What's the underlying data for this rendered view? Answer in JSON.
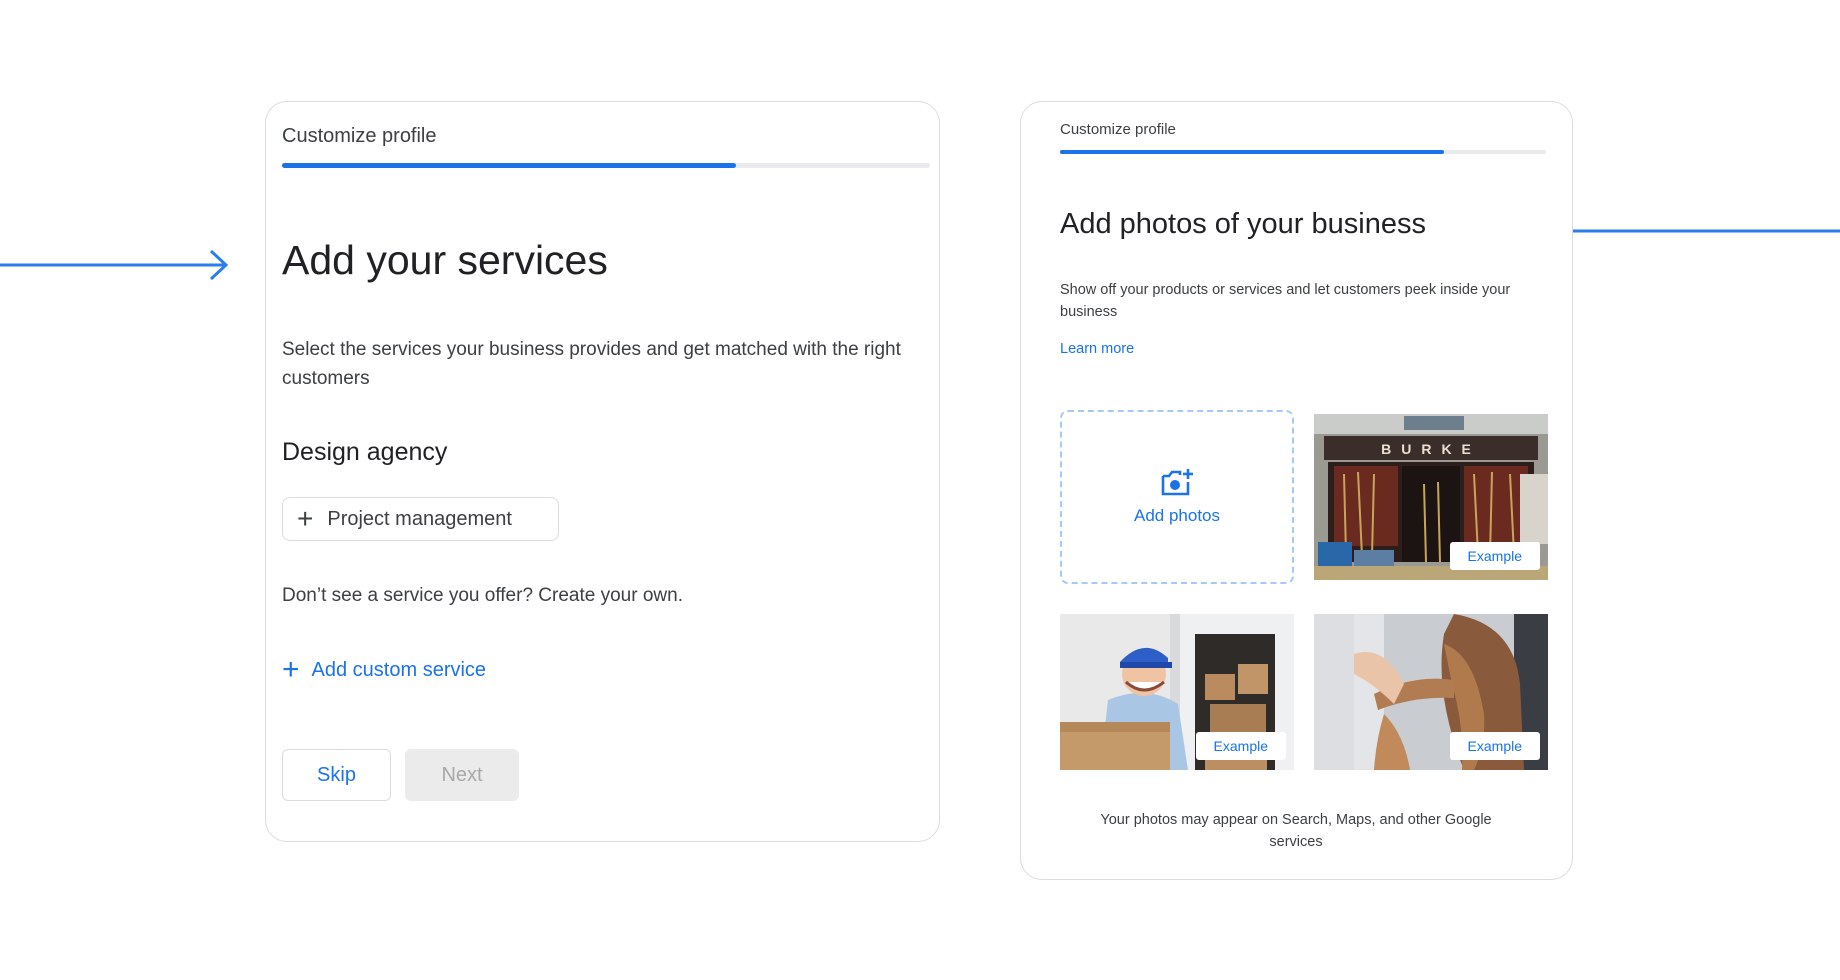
{
  "left_card": {
    "top_title": "Customize profile",
    "progress": 0.7,
    "heading": "Add your services",
    "description": "Select the services your business provides and get matched with the right customers",
    "category": "Design agency",
    "suggested_service": "Project management",
    "prompt": "Don’t see a service you offer? Create your own.",
    "add_custom_label": "Add custom service",
    "skip_label": "Skip",
    "next_label": "Next"
  },
  "right_card": {
    "top_title": "Customize profile",
    "progress": 0.79,
    "heading": "Add photos of your business",
    "description": "Show off your products or services and let customers peek inside your business",
    "learn_more": "Learn more",
    "add_photos_label": "Add photos",
    "examples": [
      {
        "badge": "Example",
        "subject": "hardware store front",
        "sign": "BURKE"
      },
      {
        "badge": "Example",
        "subject": "delivery person with box"
      },
      {
        "badge": "Example",
        "subject": "hair salon"
      }
    ],
    "footer": "Your photos may appear on Search, Maps, and other Google services"
  },
  "colors": {
    "accent": "#1a73e8",
    "arrow": "#2b7de9",
    "border": "#dadce0",
    "disabled_bg": "#ebebeb"
  },
  "icons": [
    "arrow-right-icon",
    "arrow-left-icon",
    "plus-icon",
    "add-photo-icon"
  ]
}
